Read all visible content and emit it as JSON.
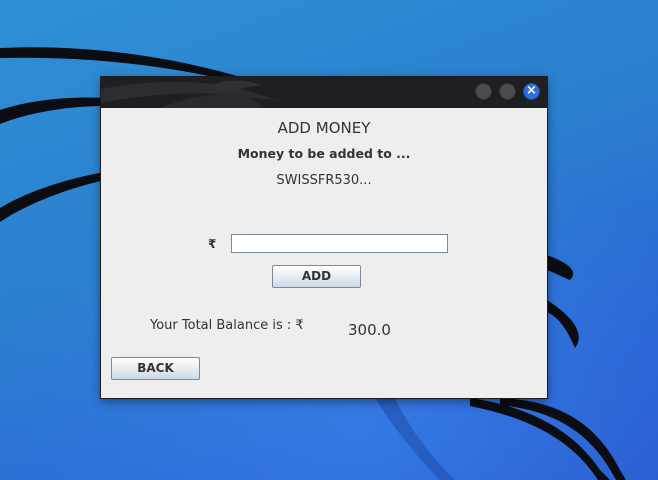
{
  "window": {
    "title": "",
    "close_glyph": "×"
  },
  "form": {
    "title": "ADD MONEY",
    "subtitle": "Money to be added to ...",
    "account": "SWISSFR530...",
    "currency_symbol": "₹",
    "amount_value": "",
    "amount_placeholder": "",
    "add_label": "ADD",
    "balance_label": "Your Total Balance is : ₹",
    "balance_value": "300.0",
    "back_label": "BACK"
  },
  "colors": {
    "desktop_background": "#2b7fcf",
    "titlebar": "#1e1f22",
    "window_background": "#eeeeee",
    "close_button": "#2f6fd8"
  },
  "icons": {
    "minimize": "minimize-icon",
    "maximize": "maximize-icon",
    "close": "close-icon",
    "wallpaper": "kali-dragon-icon"
  }
}
